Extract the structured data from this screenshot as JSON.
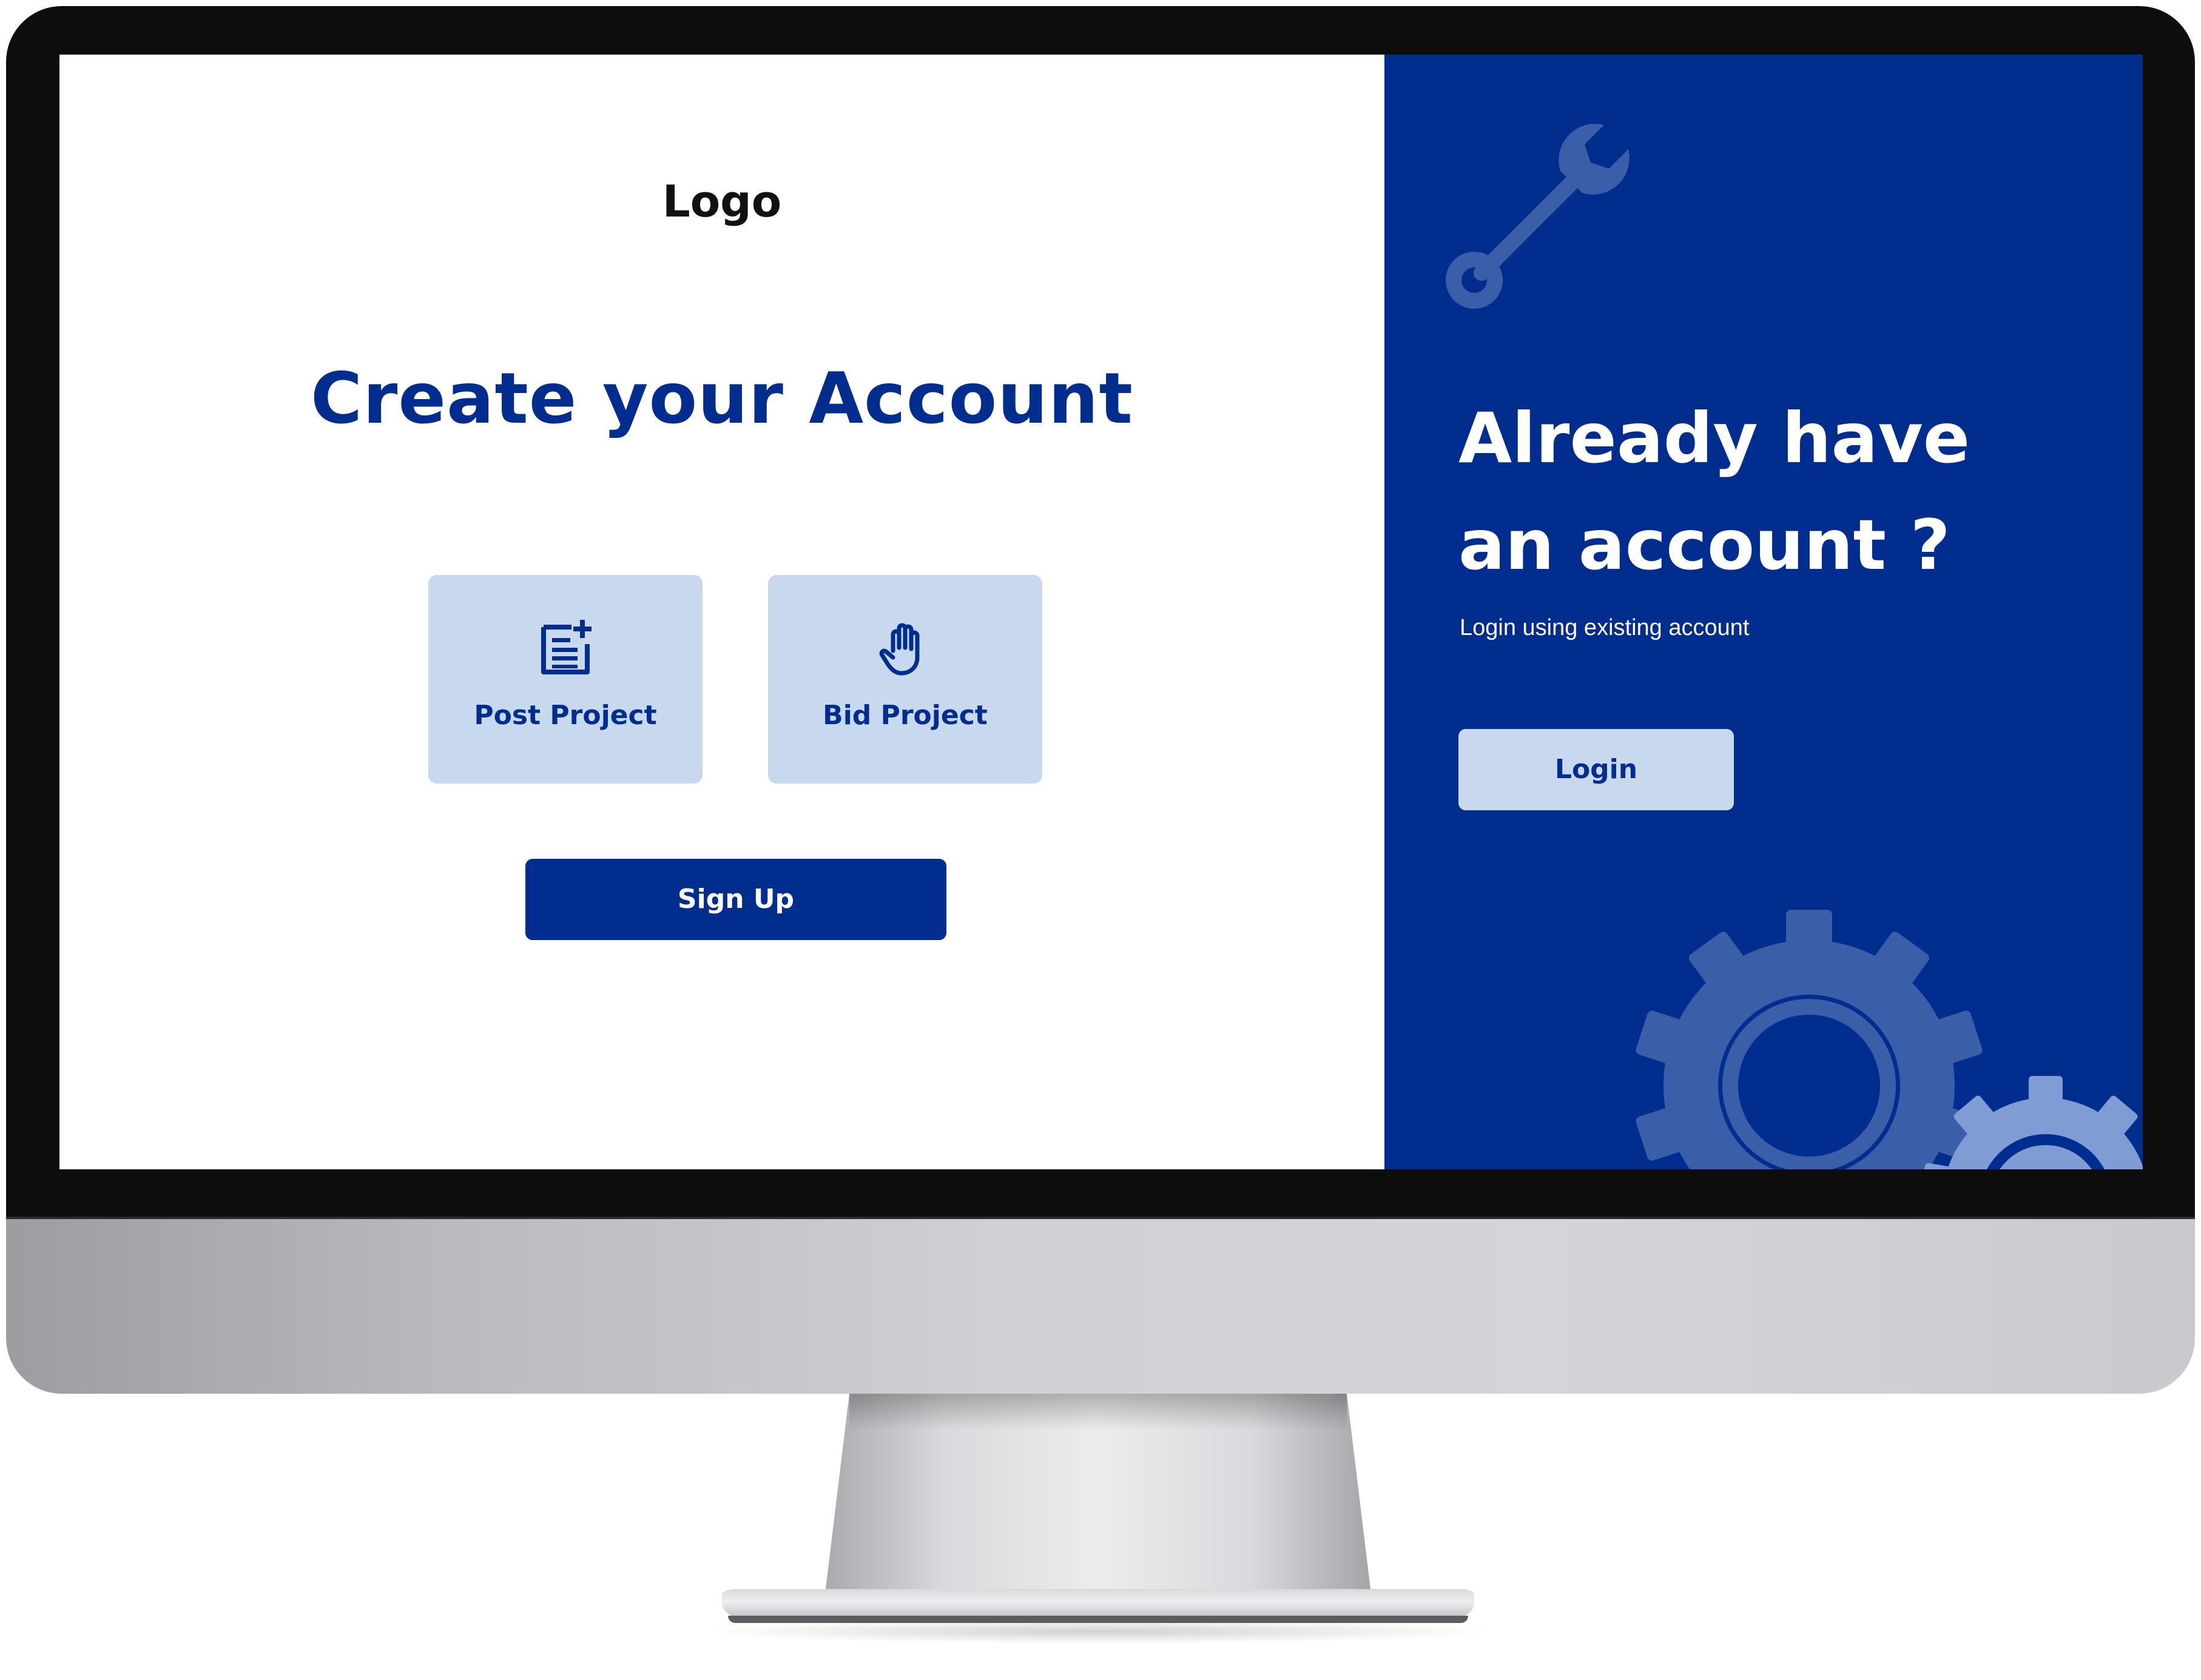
{
  "brand": {
    "logo": "Logo",
    "primary_color": "#012d8f",
    "card_color": "#c8d9ee"
  },
  "signup": {
    "title": "Create your Account",
    "roles": [
      {
        "label": "Post Project",
        "icon": "document-add-icon"
      },
      {
        "label": "Bid Project",
        "icon": "raised-hand-icon"
      }
    ],
    "submit_label": "Sign Up"
  },
  "login": {
    "title_line1": "Already have",
    "title_line2": "an account ?",
    "subtitle": "Login using existing account",
    "button_label": "Login",
    "decorations": [
      "wrench-icon",
      "gear-icon",
      "gear-icon"
    ]
  }
}
